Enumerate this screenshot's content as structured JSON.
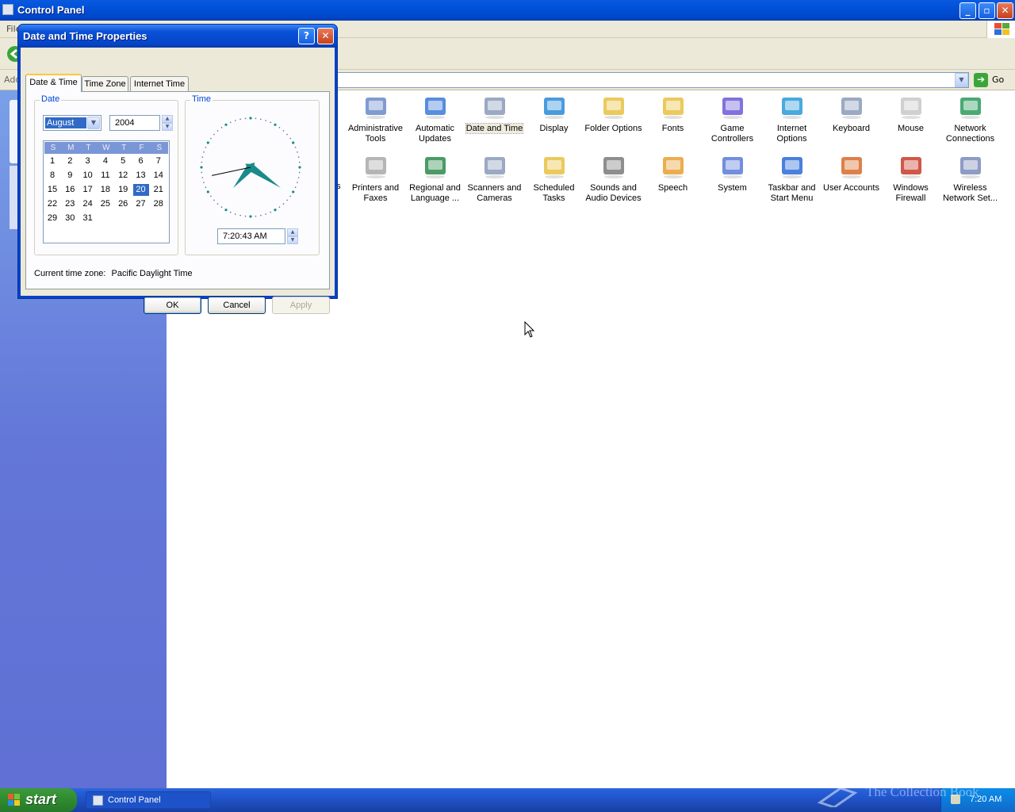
{
  "main_window": {
    "title": "Control Panel",
    "menu_first": "File",
    "address_label": "Address",
    "go_label": "Go",
    "caption_buttons": {
      "minimize": "_",
      "maximize": "▫",
      "close": "✕"
    }
  },
  "control_panel_items": [
    {
      "label": "Administrative Tools",
      "icon": "administrative-tools-icon"
    },
    {
      "label": "Automatic Updates",
      "icon": "automatic-updates-icon"
    },
    {
      "label": "Date and Time",
      "icon": "date-time-icon",
      "selected": true
    },
    {
      "label": "Display",
      "icon": "display-icon"
    },
    {
      "label": "Folder Options",
      "icon": "folder-options-icon"
    },
    {
      "label": "Fonts",
      "icon": "fonts-icon"
    },
    {
      "label": "Game Controllers",
      "icon": "game-controllers-icon"
    },
    {
      "label": "Internet Options",
      "icon": "internet-options-icon"
    },
    {
      "label": "Keyboard",
      "icon": "keyboard-icon"
    },
    {
      "label": "Mouse",
      "icon": "mouse-icon"
    },
    {
      "label": "Network Connections",
      "icon": "network-connections-icon"
    },
    {
      "label": "Printers and Faxes",
      "icon": "printers-icon"
    },
    {
      "label": "Regional and Language ...",
      "icon": "regional-icon"
    },
    {
      "label": "Scanners and Cameras",
      "icon": "scanners-icon"
    },
    {
      "label": "Scheduled Tasks",
      "icon": "scheduled-tasks-icon"
    },
    {
      "label": "Sounds and Audio Devices",
      "icon": "sounds-icon"
    },
    {
      "label": "Speech",
      "icon": "speech-icon"
    },
    {
      "label": "System",
      "icon": "system-icon"
    },
    {
      "label": "Taskbar and Start Menu",
      "icon": "taskbar-icon"
    },
    {
      "label": "User Accounts",
      "icon": "user-accounts-icon"
    },
    {
      "label": "Windows Firewall",
      "icon": "firewall-icon"
    },
    {
      "label": "Wireless Network Set...",
      "icon": "wireless-icon"
    }
  ],
  "partial_item_label": "ns",
  "dialog": {
    "title": "Date and Time Properties",
    "help_glyph": "?",
    "close_glyph": "✕",
    "tabs": [
      "Date & Time",
      "Time Zone",
      "Internet Time"
    ],
    "active_tab": "Date & Time",
    "date_group_label": "Date",
    "time_group_label": "Time",
    "month": "August",
    "year": "2004",
    "weekday_headers": [
      "S",
      "M",
      "T",
      "W",
      "T",
      "F",
      "S"
    ],
    "calendar_first_weekday_index": 0,
    "days_in_month": 31,
    "selected_day": 20,
    "time_value": "7:20:43 AM",
    "clock": {
      "hours": 7,
      "minutes": 20,
      "seconds": 43
    },
    "timezone_label": "Current time zone:",
    "timezone_value": "Pacific Daylight Time",
    "buttons": {
      "ok": "OK",
      "cancel": "Cancel",
      "apply": "Apply"
    }
  },
  "taskbar": {
    "start_label": "start",
    "task_label": "Control Panel",
    "clock": "7:20 AM"
  },
  "watermark": "The Collection Book",
  "colors": {
    "xp_blue": "#0054e3",
    "start_green": "#3c9a3c",
    "selection": "#316ac5",
    "clock_hand": "#1a8a8a"
  }
}
